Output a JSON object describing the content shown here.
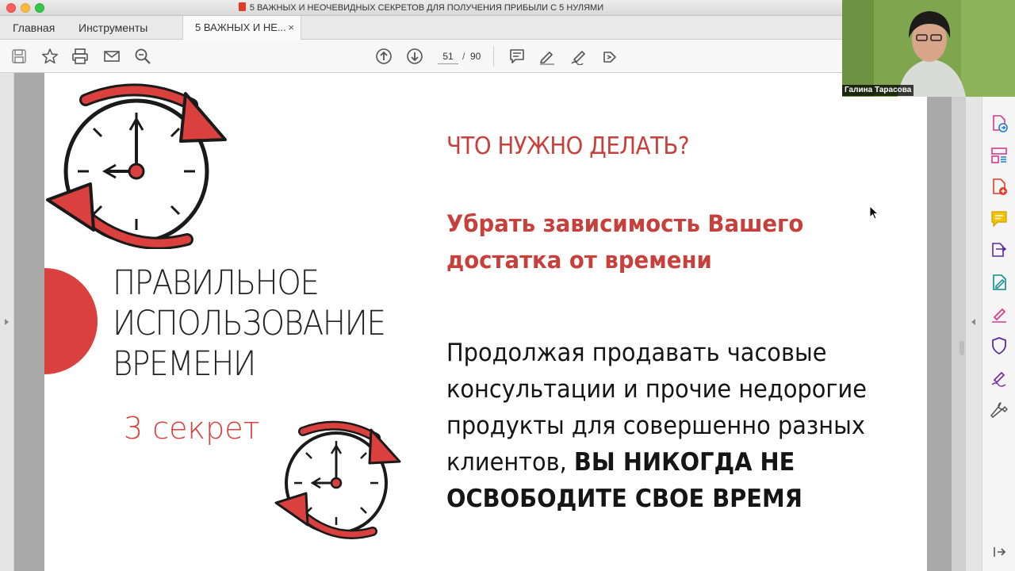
{
  "window": {
    "title": "5 ВАЖНЫХ И НЕОЧЕВИДНЫХ СЕКРЕТОВ ДЛЯ ПОЛУЧЕНИЯ ПРИБЫЛИ С 5 НУЛЯМИ"
  },
  "tabs": {
    "home": "Главная",
    "tools": "Инструменты",
    "doc": "5 ВАЖНЫХ И НЕ...",
    "close": "×"
  },
  "toolbar": {
    "icons": [
      "save-icon",
      "bookmark-star-icon",
      "print-icon",
      "email-icon",
      "zoom-search-icon",
      "page-up-icon",
      "page-down-icon",
      "comment-icon",
      "highlight-pen-icon",
      "sign-icon",
      "share-icon"
    ],
    "current_page": "51",
    "separator": "/",
    "total_pages": "90"
  },
  "webcam": {
    "name": "Галина Тарасова"
  },
  "slide": {
    "title_lines": [
      "ПРАВИЛЬНОЕ",
      "ИСПОЛЬЗОВАНИЕ",
      "ВРЕМЕНИ"
    ],
    "secret": "3 секрет",
    "question": "ЧТО НУЖНО ДЕЛАТЬ?",
    "subheading": "Убрать зависимость Вашего достатка от времени",
    "body": "Продолжая продавать часовые консультации и прочие недорогие продукты для совершенно разных клиентов,",
    "body_bold": "ВЫ НИКОГДА НЕ ОСВОБОДИТЕ СВОЕ ВРЕМЯ"
  },
  "right_pane": {
    "icons": [
      "export-pdf-icon",
      "organize-pages-icon",
      "create-pdf-icon",
      "comment-tool-icon",
      "combine-files-icon",
      "edit-pdf-icon",
      "fill-sign-icon",
      "protect-icon",
      "send-sign-icon",
      "more-tools-icon",
      "collapse-pane-icon"
    ]
  },
  "colors": {
    "accent_red": "#d9403e",
    "heading_red": "#c8403b",
    "text": "#151515"
  }
}
